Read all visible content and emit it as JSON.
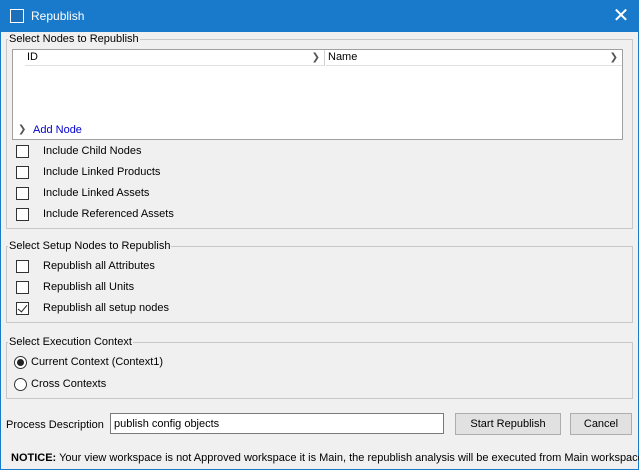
{
  "window": {
    "title": "Republish",
    "close_glyph": "✕"
  },
  "nodes_group": {
    "legend": "Select Nodes to Republish",
    "columns": [
      "ID",
      "Name"
    ],
    "add_node_label": "Add Node",
    "checkboxes": [
      {
        "label": "Include Child Nodes",
        "checked": false
      },
      {
        "label": "Include Linked Products",
        "checked": false
      },
      {
        "label": "Include Linked Assets",
        "checked": false
      },
      {
        "label": "Include Referenced Assets",
        "checked": false
      }
    ]
  },
  "setup_group": {
    "legend": "Select Setup Nodes to Republish",
    "checkboxes": [
      {
        "label": "Republish all Attributes",
        "checked": false
      },
      {
        "label": "Republish all Units",
        "checked": false
      },
      {
        "label": "Republish all setup nodes",
        "checked": true
      }
    ]
  },
  "context_group": {
    "legend": "Select Execution Context",
    "radios": [
      {
        "label": "Current Context (Context1)",
        "selected": true
      },
      {
        "label": "Cross Contexts",
        "selected": false
      }
    ]
  },
  "process": {
    "label": "Process Description",
    "value": "publish config objects"
  },
  "buttons": {
    "start": "Start Republish",
    "cancel": "Cancel"
  },
  "notice": {
    "prefix": "NOTICE:",
    "text": " Your view workspace is not Approved workspace it is Main, the republish analysis will be executed from Main workspace."
  },
  "icons": {
    "window_icon": "window-icon",
    "chevron": "chevron-right-icon"
  },
  "colors": {
    "titlebar": "#1979ca",
    "link": "#0000cc"
  }
}
